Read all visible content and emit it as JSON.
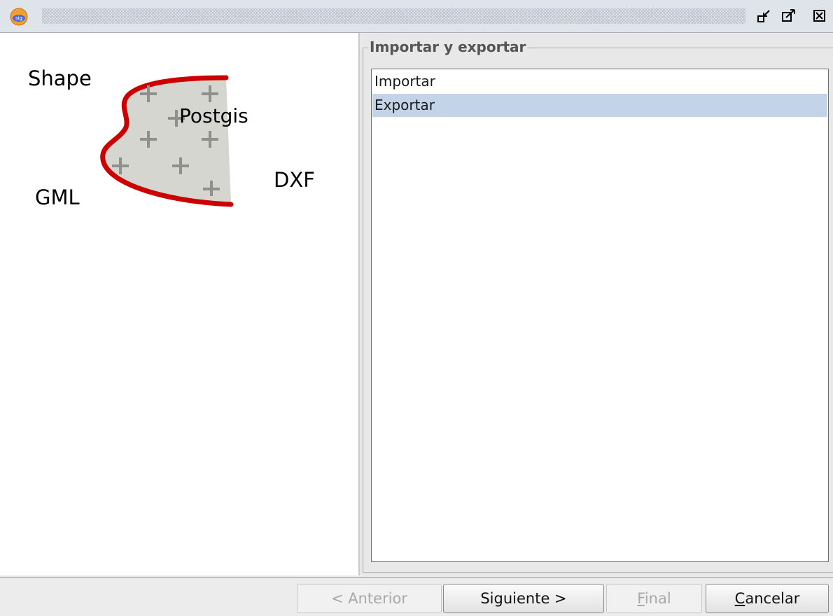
{
  "titlebar": {
    "buttons": [
      "restore-icon",
      "maximize-icon",
      "close-icon"
    ]
  },
  "illustration": {
    "labels": {
      "shape": "Shape",
      "postgis": "Postgis",
      "dxf": "DXF",
      "gml": "GML"
    },
    "colors": {
      "outline": "#cc0000",
      "fill": "#d5d6cf",
      "plus": "#8f908c"
    }
  },
  "group": {
    "title": "Importar y exportar",
    "items": [
      {
        "label": "Importar",
        "selected": false
      },
      {
        "label": "Exportar",
        "selected": true
      }
    ],
    "selection_color": "#c3d3e8"
  },
  "buttons": {
    "back": {
      "prefix": "< Anterior",
      "enabled": false
    },
    "next": {
      "label": "Siguiente >",
      "enabled": true
    },
    "finish": {
      "mnemonic": "F",
      "rest": "inal",
      "enabled": false
    },
    "cancel": {
      "mnemonic": "C",
      "rest": "ancelar",
      "enabled": true
    }
  }
}
